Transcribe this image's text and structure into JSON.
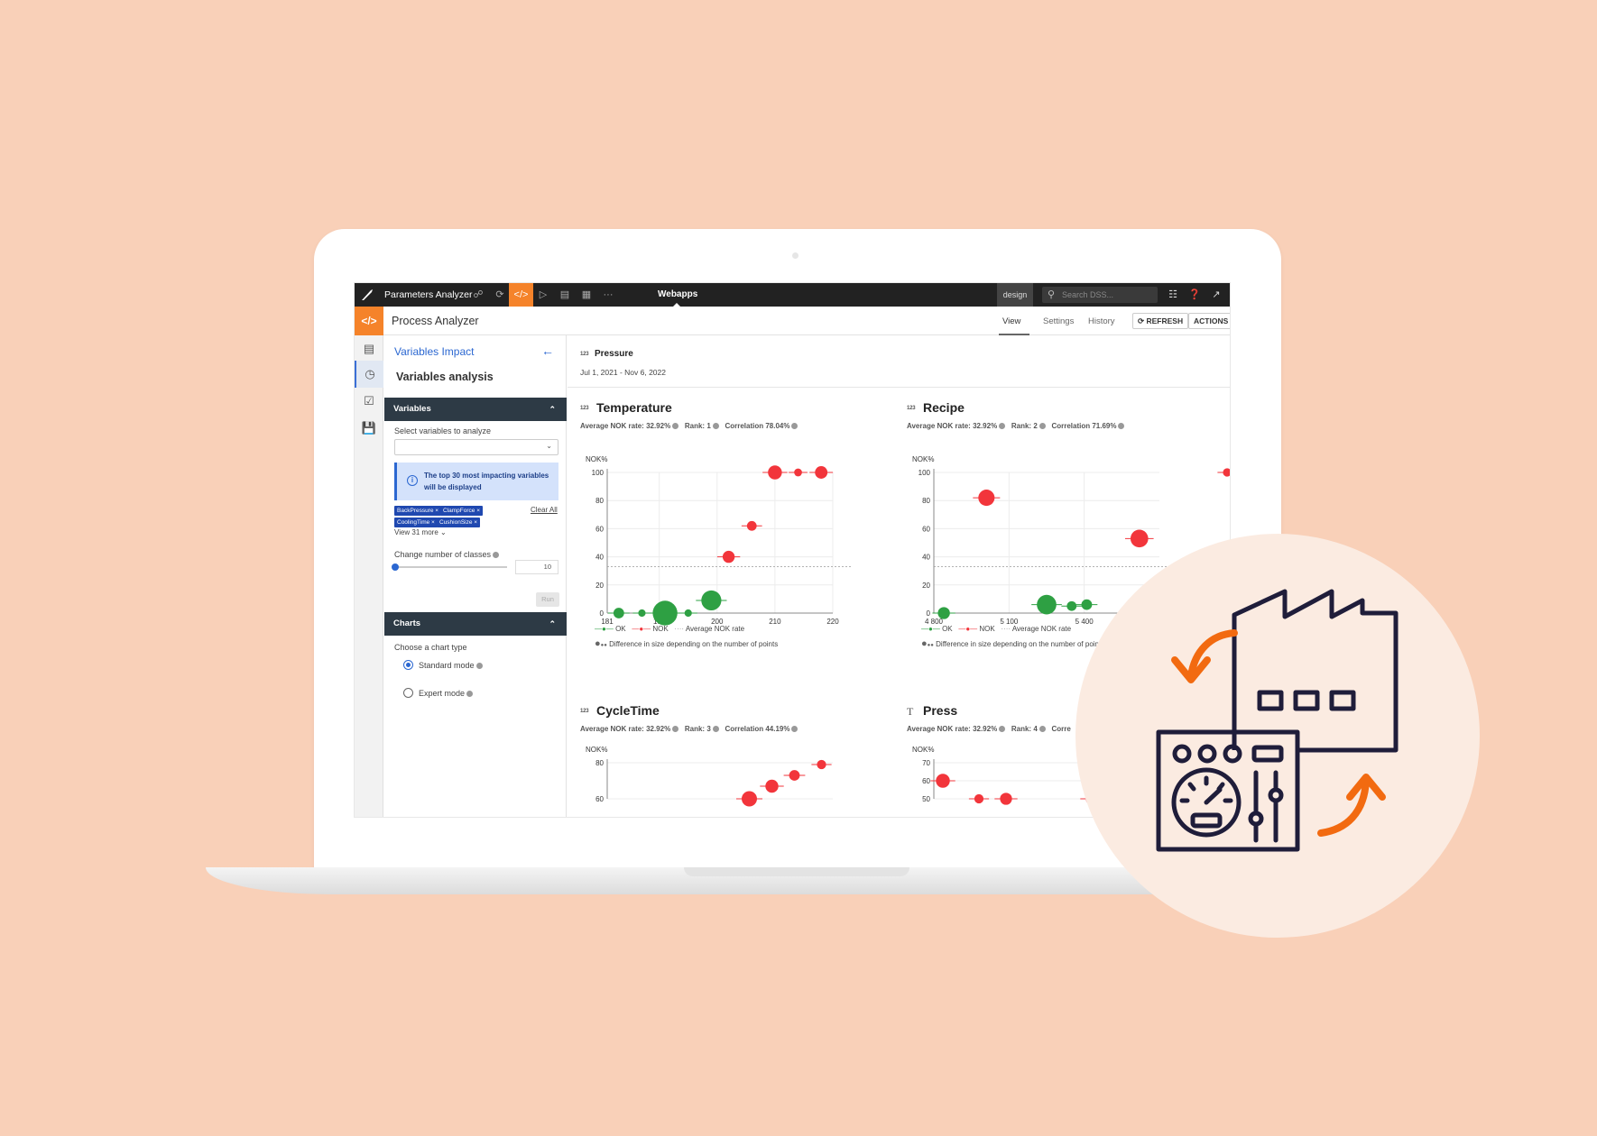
{
  "topbar": {
    "app_name": "Parameters Analyzer",
    "active_section": "Webapps",
    "mode": "design",
    "search_placeholder": "Search DSS..."
  },
  "subbar": {
    "title": "Process Analyzer",
    "tabs": [
      "View",
      "Settings",
      "History"
    ],
    "active_tab": "View",
    "refresh_label": "REFRESH",
    "actions_label": "ACTIONS"
  },
  "panel": {
    "link": "Variables Impact",
    "heading": "Variables analysis",
    "variables_section": "Variables",
    "select_label": "Select variables to analyze",
    "info_text": "The top 30 most impacting variables will be displayed",
    "chips": [
      "BackPressure",
      "ClampForce",
      "CoolingTime",
      "CushionSize"
    ],
    "clear_all": "Clear All",
    "view_more": "View 31 more",
    "classes_label": "Change number of classes",
    "classes_value": "10",
    "run_label": "Run",
    "charts_section": "Charts",
    "chart_type_label": "Choose a chart type",
    "standard_mode": "Standard mode",
    "expert_mode": "Expert mode",
    "selected_mode": "standard"
  },
  "main": {
    "selected_variable": {
      "type_icon": "123",
      "name": "Pressure",
      "date_range": "Jul 1, 2021 - Nov 6, 2022"
    },
    "legend": {
      "ok": "OK",
      "nok": "NOK",
      "avg": "Average NOK rate",
      "size_note": "Difference in size depending on the number of points"
    }
  },
  "colors": {
    "accent": "#f5832a",
    "ok": "#2ea043",
    "nok": "#f2353b",
    "link": "#2b67d1",
    "section_bar": "#2d3a45",
    "background": "#f9d0b8",
    "icon_stroke": "#1f1d3a",
    "icon_arrow": "#f26a10"
  },
  "chart_data": [
    {
      "type": "scatter",
      "title": "Temperature",
      "type_icon": "123",
      "stats": {
        "avg_nok_rate": "32.92%",
        "rank": "1",
        "correlation": "78.04%"
      },
      "ylabel": "NOK%",
      "xlim": [
        181,
        220
      ],
      "ylim": [
        0,
        100
      ],
      "xticks": [
        "181",
        "190",
        "200",
        "210",
        "220"
      ],
      "yticks": [
        "0",
        "20",
        "40",
        "60",
        "80",
        "100"
      ],
      "avg_line": 33,
      "points": [
        {
          "x": 183,
          "y": 0,
          "s": 1.5,
          "c": "ok"
        },
        {
          "x": 187,
          "y": 0,
          "s": 0.8,
          "c": "ok"
        },
        {
          "x": 191,
          "y": 0,
          "s": 4.5,
          "c": "ok"
        },
        {
          "x": 195,
          "y": 0,
          "s": 0.8,
          "c": "ok"
        },
        {
          "x": 199,
          "y": 9,
          "s": 3.5,
          "c": "ok"
        },
        {
          "x": 202,
          "y": 40,
          "s": 1.8,
          "c": "nok"
        },
        {
          "x": 206,
          "y": 62,
          "s": 1.3,
          "c": "nok"
        },
        {
          "x": 210,
          "y": 100,
          "s": 2.2,
          "c": "nok"
        },
        {
          "x": 214,
          "y": 100,
          "s": 0.9,
          "c": "nok"
        },
        {
          "x": 218,
          "y": 100,
          "s": 1.9,
          "c": "nok"
        }
      ]
    },
    {
      "type": "scatter",
      "title": "Recipe",
      "type_icon": "123",
      "stats": {
        "avg_nok_rate": "32.92%",
        "rank": "2",
        "correlation": "71.69%"
      },
      "ylabel": "NOK%",
      "xlim": [
        4800,
        5700
      ],
      "ylim": [
        0,
        100
      ],
      "xticks": [
        "4 800",
        "5 100",
        "5 400"
      ],
      "yticks": [
        "0",
        "20",
        "40",
        "60",
        "80",
        "100"
      ],
      "avg_line": 33,
      "points": [
        {
          "x": 4840,
          "y": 0,
          "s": 1.8,
          "c": "ok"
        },
        {
          "x": 5010,
          "y": 82,
          "s": 2.7,
          "c": "nok"
        },
        {
          "x": 5250,
          "y": 6,
          "s": 3.4,
          "c": "ok"
        },
        {
          "x": 5350,
          "y": 5,
          "s": 1.3,
          "c": "ok"
        },
        {
          "x": 5410,
          "y": 6,
          "s": 1.5,
          "c": "ok"
        },
        {
          "x": 5620,
          "y": 53,
          "s": 3.0,
          "c": "nok"
        },
        {
          "x": 5970,
          "y": 100,
          "s": 1.0,
          "c": "nok"
        }
      ]
    },
    {
      "type": "scatter",
      "title": "CycleTime",
      "type_icon": "123",
      "stats": {
        "avg_nok_rate": "32.92%",
        "rank": "3",
        "correlation": "44.19%"
      },
      "ylabel": "NOK%",
      "ylim": [
        60,
        80
      ],
      "yticks": [
        "60",
        "80"
      ],
      "points": [
        {
          "x": 0.63,
          "y": 60,
          "s": 2.5,
          "c": "nok"
        },
        {
          "x": 0.73,
          "y": 67,
          "s": 2.0,
          "c": "nok"
        },
        {
          "x": 0.83,
          "y": 73,
          "s": 1.5,
          "c": "nok"
        },
        {
          "x": 0.95,
          "y": 79,
          "s": 1.2,
          "c": "nok"
        }
      ]
    },
    {
      "type": "scatter",
      "title": "Press",
      "type_icon": "T",
      "stats": {
        "avg_nok_rate": "32.92%",
        "rank": "4",
        "correlation": ""
      },
      "ylabel": "NOK%",
      "ylim": [
        50,
        70
      ],
      "yticks": [
        "50",
        "60",
        "70"
      ],
      "points": [
        {
          "x": 0.04,
          "y": 60,
          "s": 2.2,
          "c": "nok"
        },
        {
          "x": 0.2,
          "y": 50,
          "s": 1.2,
          "c": "nok"
        },
        {
          "x": 0.32,
          "y": 50,
          "s": 1.8,
          "c": "nok"
        },
        {
          "x": 0.7,
          "y": 50,
          "s": 1.8,
          "c": "nok"
        }
      ]
    }
  ]
}
